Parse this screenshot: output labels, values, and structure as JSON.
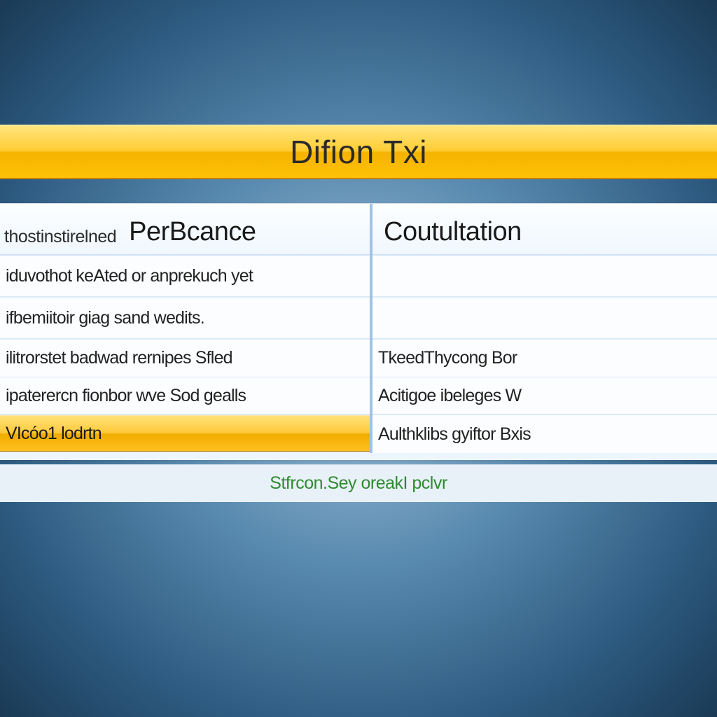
{
  "title": "Difion Txi",
  "left": {
    "header_small": "thostinstirelned",
    "header_large": "PerBcance",
    "rows": [
      "iduvothot keAted or anprekuch yet",
      "ifbemiitoir giag sand wedits.",
      "ilitrorstet badwad rernipes Sfled",
      "ipaterercn fionbor wve Sod gealls"
    ],
    "selected": "VIcóo1 lodrtn"
  },
  "right": {
    "header": "Coutultation",
    "rows": [
      "",
      "",
      "TkeedThycong Bor",
      "Acitigoe ibeleges W",
      "Aulthklibs gyiftor Bxis"
    ]
  },
  "status": "Stfrcon.Sey oreakI pclvr"
}
